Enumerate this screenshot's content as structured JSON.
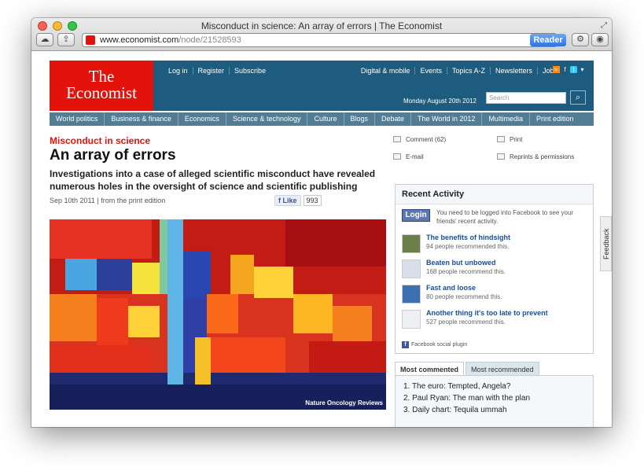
{
  "window": {
    "title": "Misconduct in science: An array of errors | The Economist",
    "url_host": "www.economist.com",
    "url_path": "/node/21528593",
    "reader_label": "Reader"
  },
  "masthead": {
    "logo_line1": "The",
    "logo_line2": "Economist",
    "top_left": [
      "Log in",
      "Register",
      "Subscribe"
    ],
    "top_right": [
      "Digital & mobile",
      "Events",
      "Topics A-Z",
      "Newsletters",
      "Jobs"
    ],
    "date": "Monday August 20th 2012",
    "search_placeholder": "Search"
  },
  "sections": [
    "World politics",
    "Business & finance",
    "Economics",
    "Science & technology",
    "Culture",
    "Blogs",
    "Debate",
    "The World in 2012",
    "Multimedia",
    "Print edition"
  ],
  "article": {
    "kicker": "Misconduct in science",
    "headline": "An array of errors",
    "rubric": "Investigations into a case of alleged scientific misconduct have revealed numerous holes in the oversight of science and scientific publishing",
    "dateline": "Sep 10th 2011 | from the print edition",
    "like_label": "Like",
    "like_count": "993",
    "image_credit": "Nature Oncology Reviews"
  },
  "tools": {
    "comment": "Comment (62)",
    "email": "E-mail",
    "print": "Print",
    "reprints": "Reprints & permissions"
  },
  "recent_activity": {
    "title": "Recent Activity",
    "login": "Login",
    "message": "You need to be logged into Facebook to see your friends' recent activity.",
    "items": [
      {
        "title": "The benefits of hindsight",
        "count": "94 people recommended this."
      },
      {
        "title": "Beaten but unbowed",
        "count": "168 people recommend this."
      },
      {
        "title": "Fast and loose",
        "count": "80 people recommend this."
      },
      {
        "title": "Another thing it's too late to prevent",
        "count": "527 people recommend this."
      }
    ],
    "plugin": "Facebook social plugin"
  },
  "most": {
    "tab_commented": "Most commented",
    "tab_recommended": "Most recommended",
    "items": [
      "1.  The euro: Tempted, Angela?",
      "2.  Paul Ryan: The man with the plan",
      "3.  Daily chart: Tequila ummah"
    ]
  },
  "feedback": "Feedback"
}
